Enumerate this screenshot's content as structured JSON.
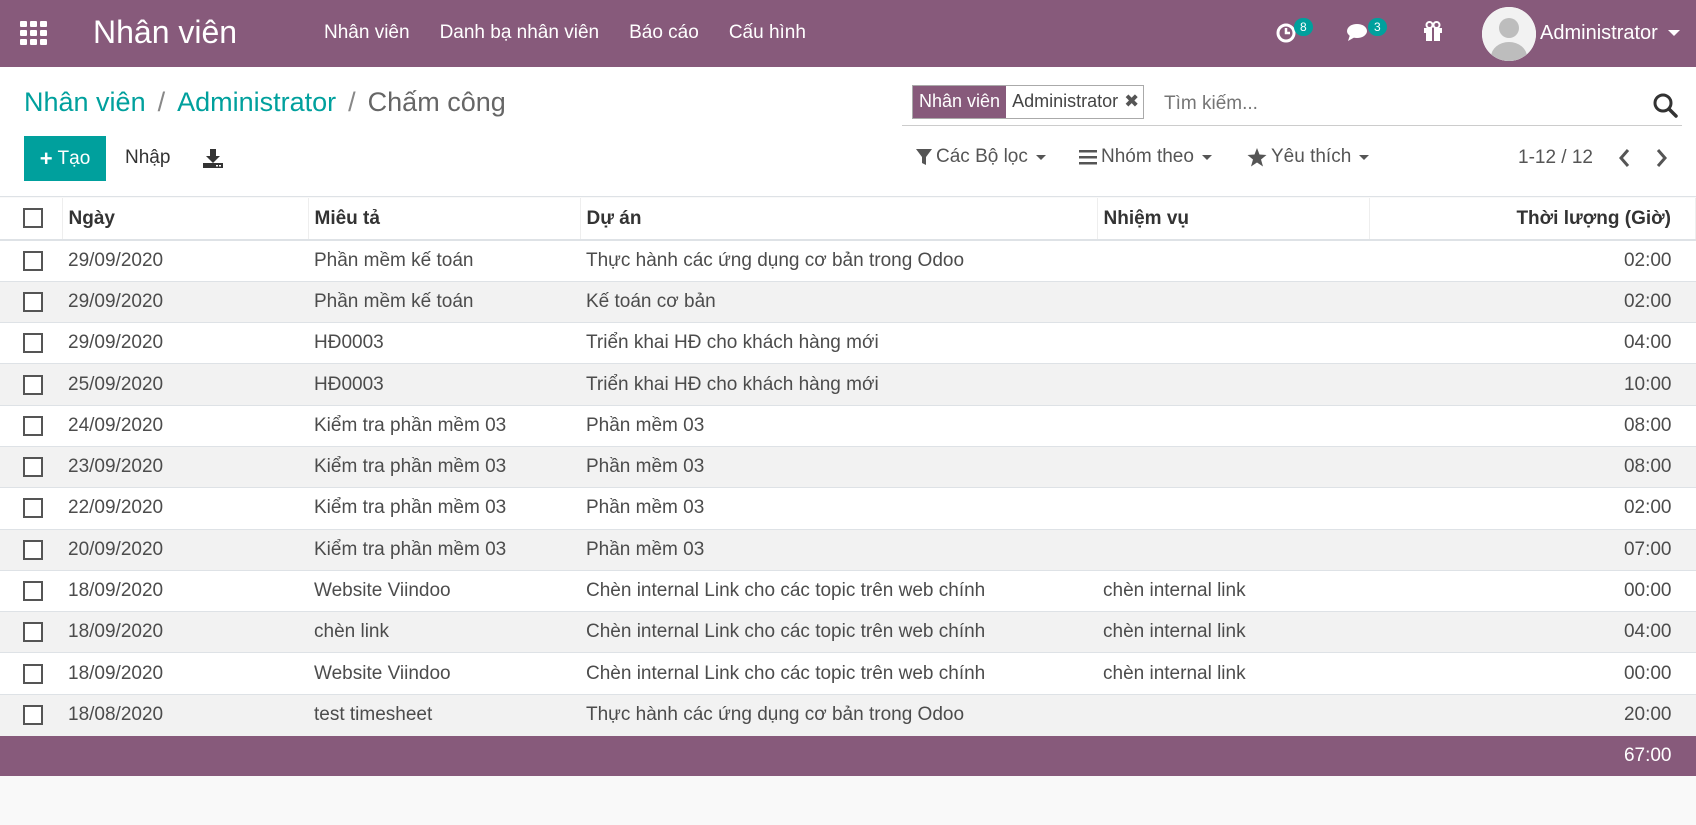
{
  "navbar": {
    "brand": "Nhân viên",
    "menu": [
      "Nhân viên",
      "Danh bạ nhân viên",
      "Báo cáo",
      "Cấu hình"
    ],
    "activity_count": "8",
    "message_count": "3",
    "user_name": "Administrator"
  },
  "breadcrumb": [
    "Nhân viên",
    "Administrator",
    "Chấm công"
  ],
  "buttons": {
    "create": "Tạo",
    "import": "Nhập"
  },
  "search": {
    "facet_category": "Nhân viên",
    "facet_value": "Administrator",
    "placeholder": "Tìm kiếm..."
  },
  "filters": {
    "filter": "Các Bộ lọc",
    "group_by": "Nhóm theo",
    "favorites": "Yêu thích"
  },
  "pager": "1-12 / 12",
  "table": {
    "columns": [
      "Ngày",
      "Miêu tả",
      "Dự án",
      "Nhiệm vụ",
      "Thời lượng (Giờ)"
    ],
    "rows": [
      [
        "29/09/2020",
        "Phần mềm kế toán",
        "Thực hành các ứng dụng cơ bản trong Odoo",
        "",
        "02:00"
      ],
      [
        "29/09/2020",
        "Phần mềm kế toán",
        "Kế toán cơ bản",
        "",
        "02:00"
      ],
      [
        "29/09/2020",
        "HĐ0003",
        "Triển khai HĐ cho khách hàng mới",
        "",
        "04:00"
      ],
      [
        "25/09/2020",
        "HĐ0003",
        "Triển khai HĐ cho khách hàng mới",
        "",
        "10:00"
      ],
      [
        "24/09/2020",
        "Kiểm tra phần mềm 03",
        "Phần mềm 03",
        "",
        "08:00"
      ],
      [
        "23/09/2020",
        "Kiểm tra phần mềm 03",
        "Phần mềm 03",
        "",
        "08:00"
      ],
      [
        "22/09/2020",
        "Kiểm tra phần mềm 03",
        "Phần mềm 03",
        "",
        "02:00"
      ],
      [
        "20/09/2020",
        "Kiểm tra phần mềm 03",
        "Phần mềm 03",
        "",
        "07:00"
      ],
      [
        "18/09/2020",
        "Website Viindoo",
        "Chèn internal Link cho các topic trên web chính",
        "chèn internal link",
        "00:00"
      ],
      [
        "18/09/2020",
        "chèn link",
        "Chèn internal Link cho các topic trên web chính",
        "chèn internal link",
        "04:00"
      ],
      [
        "18/09/2020",
        "Website Viindoo",
        "Chèn internal Link cho các topic trên web chính",
        "chèn internal link",
        "00:00"
      ],
      [
        "18/08/2020",
        "test timesheet",
        "Thực hành các ứng dụng cơ bản trong Odoo",
        "",
        "20:00"
      ]
    ],
    "total": "67:00"
  },
  "colors": {
    "primary": "#875a7b",
    "accent": "#00a09d"
  }
}
